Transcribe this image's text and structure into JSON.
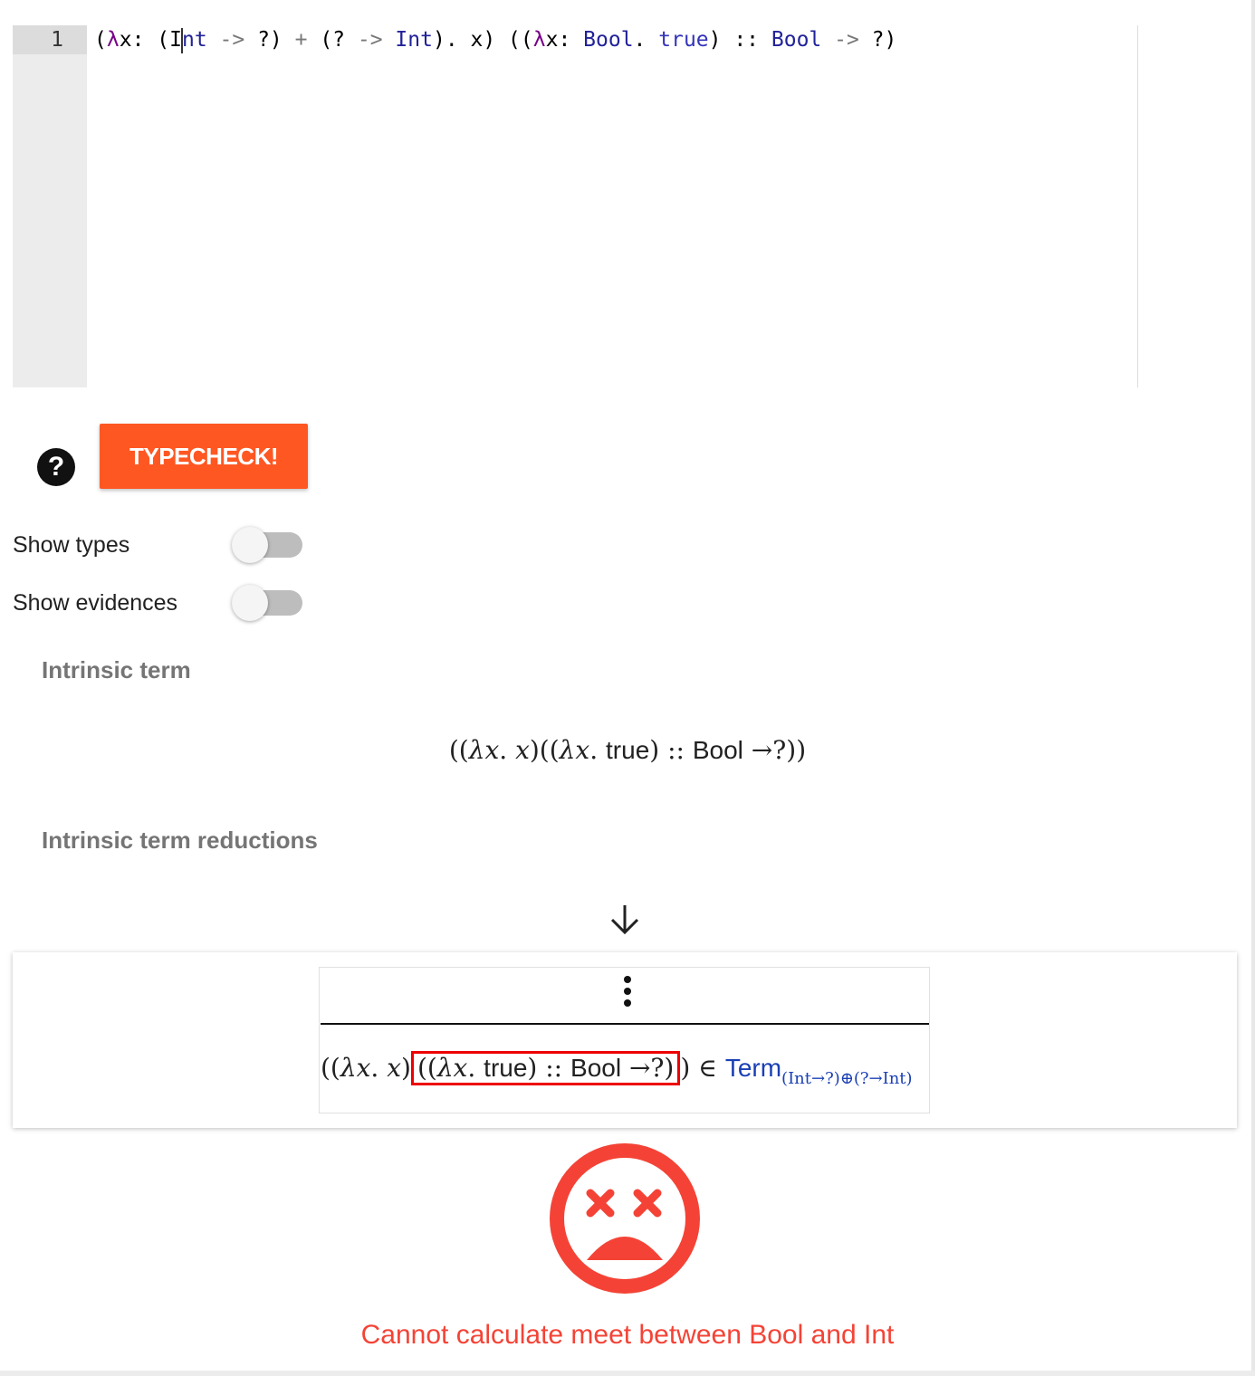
{
  "editor": {
    "line_number": "1",
    "code_tokens": [
      {
        "text": "(",
        "cls": ""
      },
      {
        "text": "λ",
        "cls": "tok-lambda"
      },
      {
        "text": "x: (I",
        "cls": ""
      },
      {
        "text": "CURSOR",
        "cls": "cursor"
      },
      {
        "text": "nt",
        "cls": "tok-type"
      },
      {
        "text": " -> ",
        "cls": "tok-op"
      },
      {
        "text": "?) ",
        "cls": ""
      },
      {
        "text": "+",
        "cls": "tok-op"
      },
      {
        "text": " (? ",
        "cls": ""
      },
      {
        "text": "->",
        "cls": "tok-op"
      },
      {
        "text": " ",
        "cls": ""
      },
      {
        "text": "Int",
        "cls": "tok-type"
      },
      {
        "text": "). x) ((",
        "cls": ""
      },
      {
        "text": "λ",
        "cls": "tok-lambda"
      },
      {
        "text": "x: ",
        "cls": ""
      },
      {
        "text": "Bool",
        "cls": "tok-type"
      },
      {
        "text": ". ",
        "cls": ""
      },
      {
        "text": "true",
        "cls": "tok-atom"
      },
      {
        "text": ") :: ",
        "cls": ""
      },
      {
        "text": "Bool",
        "cls": "tok-type"
      },
      {
        "text": " -> ",
        "cls": "tok-op"
      },
      {
        "text": "?)",
        "cls": ""
      }
    ]
  },
  "help_button": {
    "label": "?"
  },
  "typecheck_button": {
    "label": "TYPECHECK!"
  },
  "toggles": {
    "show_types": {
      "label": "Show types",
      "on": false
    },
    "show_evidences": {
      "label": "Show evidences",
      "on": false
    }
  },
  "sections": {
    "intrinsic_term": "Intrinsic term",
    "intrinsic_term_reductions": "Intrinsic term reductions"
  },
  "intrinsic_term_expr": {
    "open": "((",
    "lambda_x": "λx",
    "dot1": ". ",
    "x": "x",
    "mid": ")((",
    "lambda_x2": "λx",
    "dot2": ". ",
    "true_kw": "true",
    "close_asc": ") :: ",
    "bool_kw": "Bool",
    "arrow_q": " →?))"
  },
  "reduction_arrow": "↓",
  "derivation": {
    "vdots": "⋮",
    "conclusion": {
      "prefix_open": "((",
      "lambda_x": "λx",
      "dot1": ". ",
      "x": "x",
      "prefix_close": ")",
      "highlight_open": "((",
      "highlight_lambda": "λx",
      "highlight_dot": ". ",
      "highlight_true": "true",
      "highlight_asc": ") :: ",
      "highlight_bool": "Bool",
      "highlight_arrow": " →?)",
      "suffix": ") ∈ ",
      "term_label": "Term",
      "term_sub": "(Int→?)⊕(?→Int)"
    }
  },
  "error": {
    "icon": "sad-face-icon",
    "message": "Cannot calculate meet between Bool and Int",
    "color": "#f44336"
  },
  "colors": {
    "typecheck": "#ff5722",
    "error": "#f44336",
    "highlight_border": "#ee0000",
    "term_label": "#1a3fb5"
  }
}
